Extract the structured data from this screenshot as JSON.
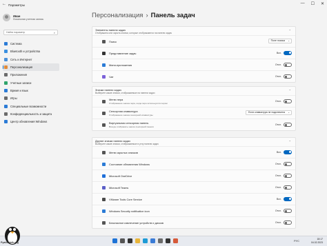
{
  "window": {
    "title": "Параметры",
    "controls": [
      "—",
      "☐",
      "✕"
    ]
  },
  "user": {
    "name": "Иван",
    "role": "Локальная учетная запись"
  },
  "search": {
    "placeholder": "Найти параметр"
  },
  "nav": {
    "items": [
      {
        "label": "Система",
        "icon": "system-icon",
        "color": "#2b7bd6"
      },
      {
        "label": "Bluetooth и устройства",
        "icon": "bluetooth-icon",
        "color": "#3a8fe0"
      },
      {
        "label": "Сеть и Интернет",
        "icon": "network-icon",
        "color": "#4a90d9"
      },
      {
        "label": "Персонализация",
        "icon": "brush-icon",
        "color": "#e08a3a",
        "active": true
      },
      {
        "label": "Приложения",
        "icon": "apps-icon",
        "color": "#6b6b6b"
      },
      {
        "label": "Учетные записи",
        "icon": "account-icon",
        "color": "#2fa36b"
      },
      {
        "label": "Время и язык",
        "icon": "globe-icon",
        "color": "#2b7bd6"
      },
      {
        "label": "Игры",
        "icon": "gamepad-icon",
        "color": "#6b6b6b"
      },
      {
        "label": "Специальные возможности",
        "icon": "accessibility-icon",
        "color": "#2b7bd6"
      },
      {
        "label": "Конфиденциальность и защита",
        "icon": "shield-icon",
        "color": "#6b6b6b"
      },
      {
        "label": "Центр обновления Windows",
        "icon": "update-icon",
        "color": "#2b7bd6"
      }
    ]
  },
  "breadcrumb": {
    "parent": "Персонализация",
    "separator": "›",
    "current": "Панель задач"
  },
  "sections": [
    {
      "title": "Элементы панели задач",
      "desc": "Отображать или скрыть кнопки, которые отображаются на панели задач",
      "rows": [
        {
          "label": "Поиск",
          "icon": "search-icon",
          "color": "#555555",
          "control": "dropdown",
          "value": "Поле поиска"
        },
        {
          "label": "Представление задач",
          "icon": "taskview-icon",
          "color": "#333333",
          "control": "toggle",
          "state": "Вкл.",
          "on": true
        },
        {
          "label": "Мини-приложения",
          "icon": "widgets-icon",
          "color": "#2b7bd6",
          "control": "toggle",
          "state": "Откл.",
          "on": false
        },
        {
          "label": "Чат",
          "icon": "chat-icon",
          "color": "#7b61d9",
          "control": "toggle",
          "state": "Откл.",
          "on": false
        }
      ]
    },
    {
      "title": "Значки панели задач",
      "desc": "Выберите какие значки, отображаемые на панели задач",
      "rows": [
        {
          "label": "Меню пера",
          "sub": "Отображение значка пера, когда перо используется пером",
          "icon": "pen-icon",
          "color": "#555555",
          "control": "toggle",
          "state": "Откл.",
          "on": false
        },
        {
          "label": "Сенсорная клавиатура",
          "sub": "Отображение значка сенсорной клавиатуры",
          "icon": "keyboard-icon",
          "color": "#555555",
          "control": "dropdown",
          "value": "Если клавиатура не подключена"
        },
        {
          "label": "Виртуальная сенсорная панель",
          "sub": "Всегда отображать значок сенсорной панели",
          "icon": "touchpad-icon",
          "color": "#555555",
          "control": "toggle",
          "state": "Откл.",
          "on": false
        }
      ]
    },
    {
      "title": "Другие значки панели задач",
      "desc": "Выберите какие значки, отображаемые в углу панели задач",
      "rows": [
        {
          "label": "Меню скрытых значков",
          "icon": "chevron-up-icon",
          "color": "#555555",
          "control": "toggle",
          "state": "Вкл.",
          "on": true
        },
        {
          "label": "Состояние обновления Windows",
          "icon": "update-icon",
          "color": "#2b7bd6",
          "control": "toggle",
          "state": "Откл.",
          "on": false
        },
        {
          "label": "Microsoft OneDrive",
          "icon": "onedrive-icon",
          "color": "#1e6fd9",
          "control": "toggle",
          "state": "Откл.",
          "on": false
        },
        {
          "label": "Microsoft Teams",
          "icon": "teams-icon",
          "color": "#5b5fc7",
          "control": "toggle",
          "state": "Откл.",
          "on": false
        },
        {
          "label": "VMware Tools Core Service",
          "icon": "vmware-icon",
          "color": "#4a4a4a",
          "control": "toggle",
          "state": "Вкл.",
          "on": true
        },
        {
          "label": "Windows Security notification icon",
          "icon": "security-icon",
          "color": "#2b7bd6",
          "control": "toggle",
          "state": "Откл.",
          "on": false
        },
        {
          "label": "Безопасное извлечение устройств и дисков",
          "icon": "usb-icon",
          "color": "#555555",
          "control": "toggle",
          "state": "Откл.",
          "on": false
        }
      ]
    }
  ],
  "taskbar": {
    "icons": [
      {
        "name": "start-icon",
        "color": "#1e73d6"
      },
      {
        "name": "search-icon",
        "color": "#555555"
      },
      {
        "name": "taskview-icon",
        "color": "#333333"
      },
      {
        "name": "explorer-icon",
        "color": "#e8b53a"
      },
      {
        "name": "edge-icon",
        "color": "#1e9bd6"
      },
      {
        "name": "store-icon",
        "color": "#3a7bd6"
      },
      {
        "name": "settings-icon",
        "color": "#6b6b6b"
      },
      {
        "name": "terminal-icon",
        "color": "#333333"
      },
      {
        "name": "paint-icon",
        "color": "#d65a3a"
      }
    ],
    "lang": "РУС",
    "time": "18:17",
    "date": "04.02.2023"
  },
  "watermark": {
    "text": "Pyatilistnik.org"
  }
}
